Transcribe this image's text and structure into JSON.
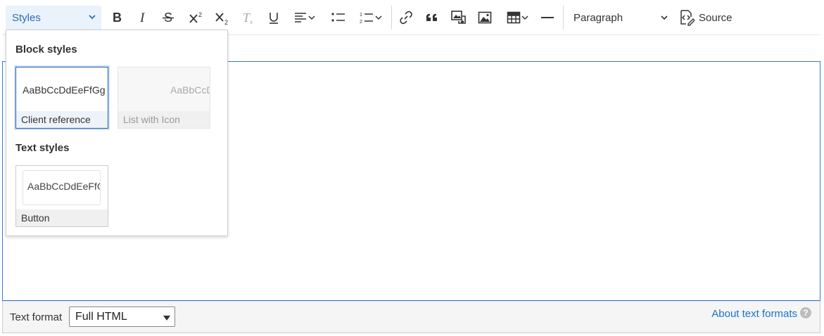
{
  "toolbar": {
    "styles_label": "Styles",
    "paragraph_label": "Paragraph",
    "source_label": "Source",
    "buttons": [
      {
        "name": "bold-button",
        "icon": "bold-icon"
      },
      {
        "name": "italic-button",
        "icon": "italic-icon"
      },
      {
        "name": "strikethrough-button",
        "icon": "strikethrough-icon"
      },
      {
        "name": "superscript-button",
        "icon": "superscript-icon"
      },
      {
        "name": "subscript-button",
        "icon": "subscript-icon"
      },
      {
        "name": "remove-format-button",
        "icon": "remove-format-icon"
      },
      {
        "name": "underline-button",
        "icon": "underline-icon"
      },
      {
        "name": "align-button",
        "icon": "align-left-icon"
      },
      {
        "name": "bulleted-list-button",
        "icon": "bulleted-list-icon"
      },
      {
        "name": "numbered-list-button",
        "icon": "numbered-list-icon"
      },
      {
        "name": "link-button",
        "icon": "link-icon"
      },
      {
        "name": "blockquote-button",
        "icon": "blockquote-icon"
      },
      {
        "name": "media-button",
        "icon": "media-icon"
      },
      {
        "name": "image-button",
        "icon": "image-icon"
      },
      {
        "name": "table-button",
        "icon": "table-icon"
      },
      {
        "name": "horizontal-line-button",
        "icon": "horizontal-line-icon"
      }
    ]
  },
  "styles_panel": {
    "block_title": "Block styles",
    "text_title": "Text styles",
    "block_styles": [
      {
        "label": "Client reference",
        "preview": "AaBbCcDdEeFfGg",
        "state": "active"
      },
      {
        "label": "List with Icon",
        "preview": "AaBbCcD",
        "state": "disabled"
      }
    ],
    "text_styles": [
      {
        "label": "Button",
        "preview": "AaBbCcDdEeFfGg",
        "state": "normal"
      }
    ]
  },
  "footer": {
    "text_format_label": "Text format",
    "text_format_value": "Full HTML",
    "about_link": "About text formats",
    "help_glyph": "?"
  },
  "colors": {
    "accent": "#2d7bd4",
    "styles_dropdown_bg": "#eaf2fb",
    "link": "#1a73c8"
  }
}
